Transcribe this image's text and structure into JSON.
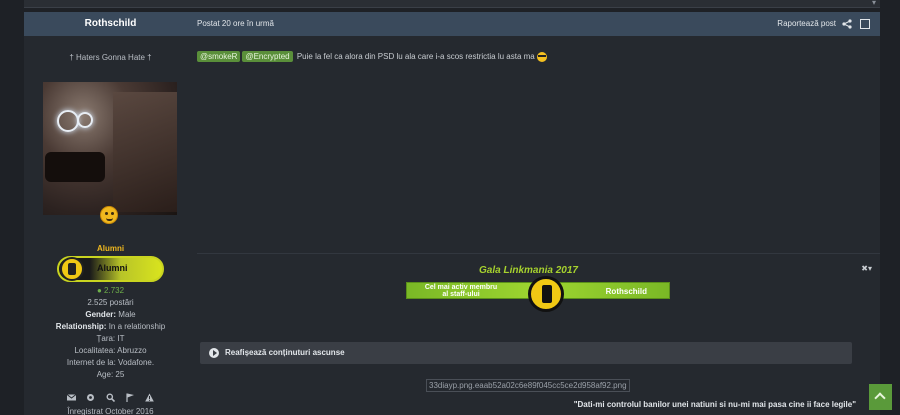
{
  "post": {
    "author": "Rothschild",
    "time": "Postat 20 ore în urmă",
    "report_label": "Raportează post",
    "tagline": "† Haters Gonna Hate †",
    "group_title": "Alumni",
    "group_badge_label": "Alumni",
    "reputation": "2.732",
    "posts": "2.525 postări",
    "gender_label": "Gender:",
    "gender_value": "Male",
    "relationship_label": "Relationship:",
    "relationship_value": "In a relationship",
    "country": "Țara: IT",
    "locality": "Localitatea: Abruzzo",
    "internet": "Internet de la: Vodafone.",
    "age": "Age: 25",
    "registered": "Înregistrat October 2016",
    "mentions": [
      "@smokeR",
      "@Encrypted"
    ],
    "body_text": "Puie la fel ca alora din PSD lu ala care i-a scos restrictia lu asta ma",
    "award_title": "Gala Linkmania 2017",
    "award_left_line1": "Cel mai activ membru",
    "award_left_line2": "al staff-ului",
    "award_right": "Rothschild",
    "spoiler_label": "Reafișează conținuturi ascunse",
    "broken_image_alt": "33diayp.png.eaab52a02c6e89f045cc5ce2d958af92.png",
    "signature_quote": "\"Dati-mi controlul banilor unei natiuni si nu-mi mai pasa cine ii face legile\"",
    "sig_menu": "✖▾"
  },
  "icons": {
    "sidebar_icons": [
      "envelope-icon",
      "gear-icon",
      "search-icon",
      "flag-icon",
      "warning-icon"
    ],
    "share": "share-icon"
  },
  "colors": {
    "header_bg": "#3a4a5c",
    "mention_bg": "#5a8f3a",
    "group_title": "#f0b81e",
    "reputation": "#6fb04a",
    "award": "#a7d22e"
  }
}
